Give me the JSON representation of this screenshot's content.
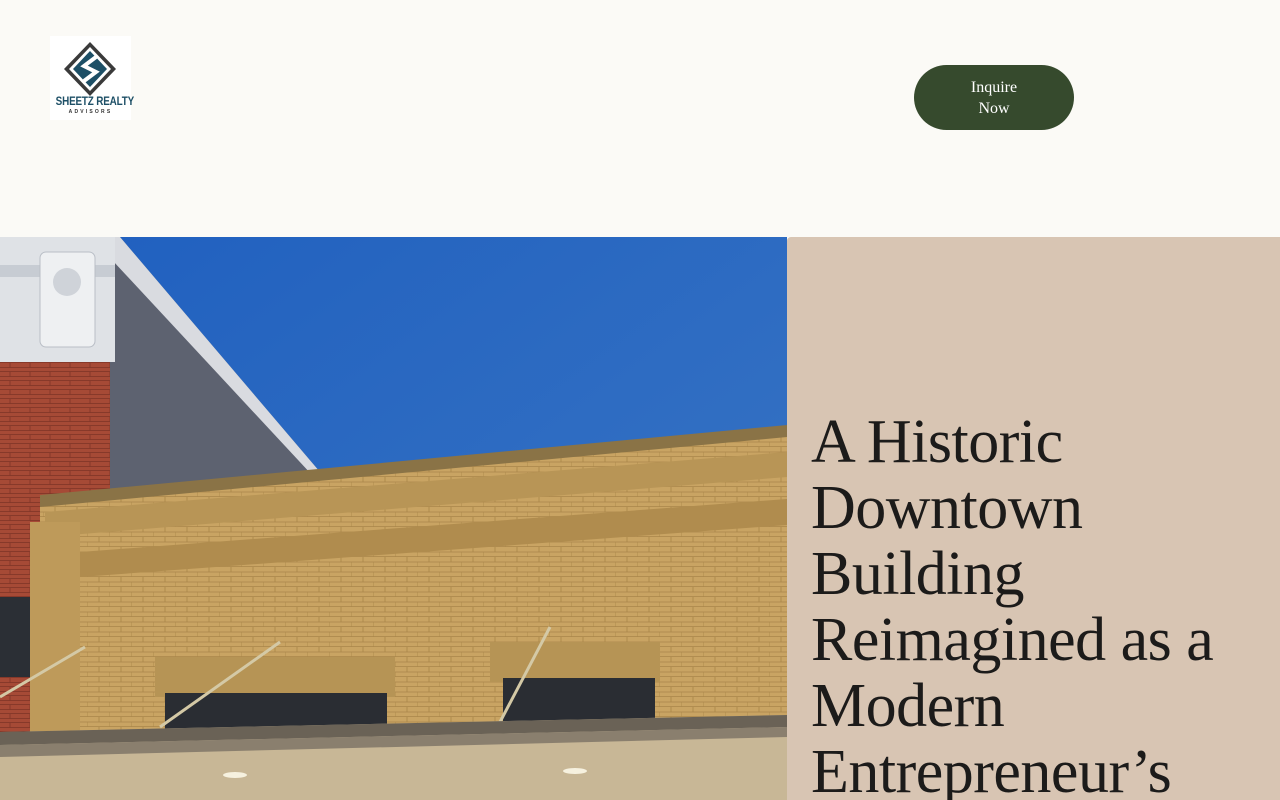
{
  "header": {
    "logo": {
      "name": "SHEETZ REALTY",
      "tagline": "ADVISORS",
      "icon": "sheetz-s-diamond-logo"
    },
    "cta_label": "Inquire Now"
  },
  "hero": {
    "image": {
      "subject": "historic-downtown-brick-building"
    },
    "title": "A Historic Downtown Building Reimagined as a Modern Entrepreneur’s",
    "panel_color": "#d8c5b3"
  },
  "colors": {
    "page_background": "#fbfaf6",
    "button_background": "#364a2d",
    "button_text": "#ffffff",
    "logo_blue": "#1d4f66",
    "sky_blue": "#2f6bbd",
    "brick_tan": "#c9a463"
  }
}
